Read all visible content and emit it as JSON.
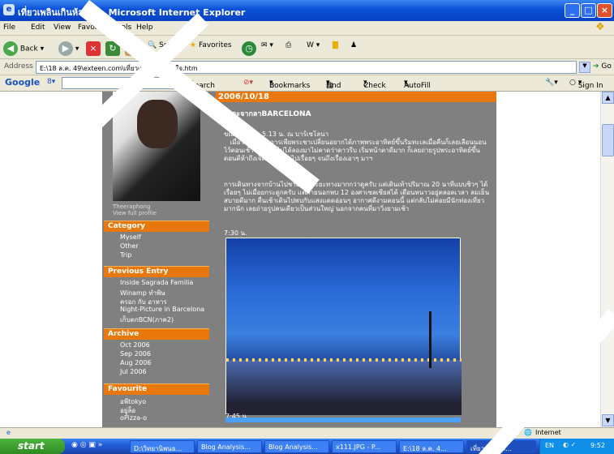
{
  "window": {
    "title": "เที่ยวเพลินเกินห้ามใจ - Microsoft Internet Explorer"
  },
  "menu": [
    "File",
    "Edit",
    "View",
    "Favorites",
    "Tools",
    "Help"
  ],
  "toolbar": {
    "back": "Back",
    "search": "Search",
    "favorites": "Favorites"
  },
  "address": {
    "label": "Address",
    "value": "E:\\18 ล.ค. 49\\exteen.com\\เที่ยวเพลินเกินห้ามใจ.htm",
    "go": "Go"
  },
  "googlebar": {
    "brand": "Google",
    "search": "Search",
    "bookmarks": "Bookmarks",
    "find": "Find",
    "check": "Check",
    "autofill": "AutoFill",
    "signin": "Sign In"
  },
  "blog": {
    "profile_name": "Theeraphong",
    "view_profile": "View full profile",
    "categories": {
      "title": "Category",
      "items": [
        "Myself",
        "Other",
        "Trip"
      ]
    },
    "previous": {
      "title": "Previous Entry",
      "items": [
        "Inside Sagrada Familia",
        "Winamp ทำพิษ",
        "ครอก กับ อาหาร",
        "Night-Picture in Barcelona",
        "เก็บตกBCN(ภาค2)"
      ]
    },
    "archive": {
      "title": "Archive",
      "items": [
        "Oct 2006",
        "Sep 2006",
        "Aug 2006",
        "Jul 2006"
      ]
    },
    "favourite": {
      "title": "Favourite",
      "items": [
        "อพีtokyo",
        "อยู่ล็อ",
        "oPizza-o"
      ]
    },
    "date": "2006/10/18",
    "post_title": "ก่อนจะจากลาBARCELONA",
    "p1": "ขณะนี้เวลา : 5.13 น. ณ บาร์เซโลนา\n   เมื่อวานเกิดอาการเพียพระชาเปลี่ยนอยากได้ภาพพระอาทิตย์ขึ้นริมทะเลเมื่อคืนก็เลยเลือนนอนไว้ตอนเช้า เพราะก็ไม่ได้ลองมาไม่คาดว่าดาวรีบ เริ่มหน้าตาดีมาก ก็เลยถ่ายรูปพระอาทิตย์ขึ้นตอนตีห้าถึงเจ็ดโมง ขยับไปเรื่อยๆ จนถึงเรื่องเอาๆ มาฯ",
    "p2": "การเดินทางจากบ้านไปชายหาดระยะทางมากกว่าดูครับ แต่เดินเท้าปริมาณ 20 นาทีแบบชิวๆ ได้เรื่อยๆ ไม่เมื่อยกระดูกครับ แต่ภายนอกพบ 12 องศาเซลเซียสได้ เดือนหนาวอยู่ตลอดเวลา ลมเย็นสบายดีมาก ตื่นเช้าเดินไปพบกับแสงแดดอ่อนๆ อากาศดีงามตอนนี้ แต่กลับไม่ค่อยมีนักท่องเที่ยวมากนัก เลยถ่ายรูปคนเดียวเป็นส่วนใหญ่ นอกจากคนที่มาวิ่งยามเช้า",
    "cap1": "7:30 น.",
    "cap2": "7:45 น."
  },
  "status": {
    "text": "Internet"
  },
  "taskbar": {
    "start": "start",
    "tasks": [
      "D:\\วิทยานิพนธ...",
      "Blog Analysis...",
      "Blog Analysis...",
      "x111.JPG - P...",
      "E:\\18 ล.ค. 4...",
      "เที่ยวเพลินเก..."
    ],
    "lang": "EN",
    "time": "9:52"
  }
}
